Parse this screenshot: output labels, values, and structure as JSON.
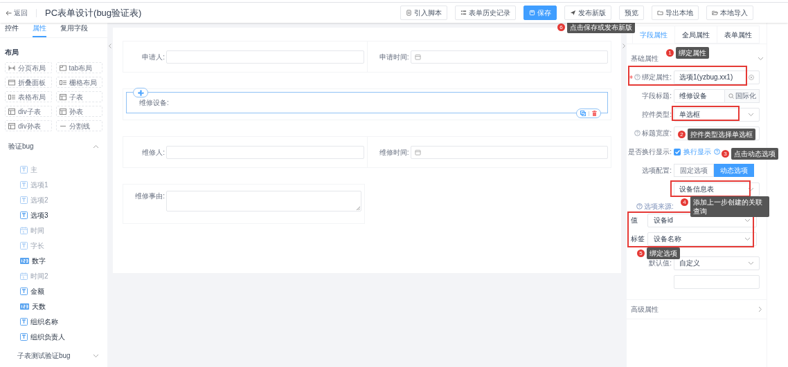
{
  "header": {
    "back": "返回",
    "title": "PC表单设计(bug验证表)",
    "buttons": [
      {
        "label": "引入脚本",
        "primary": false
      },
      {
        "label": "表单历史记录",
        "primary": false
      },
      {
        "label": "保存",
        "primary": true
      },
      {
        "label": "发布新版",
        "primary": false
      },
      {
        "label": "预览",
        "primary": false
      },
      {
        "label": "导出本地",
        "primary": false
      },
      {
        "label": "本地导入",
        "primary": false
      }
    ]
  },
  "left_panel": {
    "tabs": [
      {
        "label": "控件",
        "selected": false
      },
      {
        "label": "属性",
        "selected": true
      },
      {
        "label": "复用字段",
        "selected": false
      }
    ],
    "layout_heading": "布局",
    "layout_widgets": [
      {
        "label": "分页布局"
      },
      {
        "label": "tab布局"
      },
      {
        "label": "折叠面板"
      },
      {
        "label": "栅格布局"
      },
      {
        "label": "表格布局"
      },
      {
        "label": "子表"
      },
      {
        "label": "div子表"
      },
      {
        "label": "孙表"
      },
      {
        "label": "div孙表"
      },
      {
        "label": "分割线"
      }
    ],
    "groups": [
      {
        "title": "验证bug",
        "expanded": true,
        "fields": [
          {
            "label": "主",
            "kind": "text",
            "disabled": true
          },
          {
            "label": "选项1",
            "kind": "text",
            "disabled": true
          },
          {
            "label": "选项2",
            "kind": "text",
            "disabled": true
          },
          {
            "label": "选项3",
            "kind": "text",
            "disabled": false
          },
          {
            "label": "时间",
            "kind": "date",
            "disabled": true
          },
          {
            "label": "字长",
            "kind": "text",
            "disabled": true
          },
          {
            "label": "数字",
            "kind": "number",
            "disabled": false
          },
          {
            "label": "时间2",
            "kind": "date",
            "disabled": true
          },
          {
            "label": "金额",
            "kind": "text",
            "disabled": false
          },
          {
            "label": "天数",
            "kind": "number",
            "disabled": false
          },
          {
            "label": "组织名称",
            "kind": "text",
            "disabled": false
          },
          {
            "label": "组织负责人",
            "kind": "text",
            "disabled": false
          }
        ]
      },
      {
        "title": "子表测试验证bug",
        "expanded": false
      }
    ]
  },
  "canvas": {
    "rows": [
      {
        "selected": false,
        "cells": [
          {
            "label": "申请人:",
            "kind": "input"
          },
          {
            "label": "申请时间:",
            "kind": "date"
          }
        ]
      },
      {
        "selected": true,
        "cells": [
          {
            "label": "维修设备:",
            "kind": "radio"
          }
        ]
      },
      {
        "selected": false,
        "cells": [
          {
            "label": "维修人:",
            "kind": "input"
          },
          {
            "label": "维修时间:",
            "kind": "date"
          }
        ]
      },
      {
        "selected": false,
        "cells": [
          {
            "label": "维修事由:",
            "kind": "textarea"
          }
        ]
      }
    ]
  },
  "right_panel": {
    "tabs": [
      {
        "label": "字段属性",
        "selected": true
      },
      {
        "label": "全局属性",
        "selected": false
      },
      {
        "label": "表单属性",
        "selected": false
      }
    ],
    "section": {
      "title": "基础属性",
      "expanded": true
    },
    "properties": [
      {
        "kind": "input",
        "label": "绑定属性:",
        "required": true,
        "help": true,
        "value": "选项1(yzbug.xx1)",
        "clearable": true
      },
      {
        "kind": "addon",
        "label": "字段标题:",
        "value": "维修设备",
        "addon": "国际化"
      },
      {
        "kind": "select",
        "label": "控件类型:",
        "value": "单选框"
      },
      {
        "kind": "input",
        "label": "标题宽度:",
        "help": true
      },
      {
        "kind": "checkbox",
        "label": "是否换行显示:",
        "checked": true,
        "text": "换行显示",
        "help": true
      },
      {
        "kind": "segmented",
        "label": "选项配置:",
        "options": [
          {
            "label": "固定选项",
            "selected": false
          },
          {
            "label": "动态选项",
            "selected": true
          }
        ]
      },
      {
        "kind": "select",
        "value": "设备信息表"
      },
      {
        "kind": "caption",
        "text": "选项来源:"
      },
      {
        "kind": "bind",
        "label": "值",
        "value": "设备id"
      },
      {
        "kind": "bind",
        "label": "标签",
        "value": "设备名称"
      },
      {
        "kind": "select",
        "label": "默认值:",
        "value": "自定义"
      },
      {
        "kind": "input"
      }
    ],
    "advanced": {
      "title": "高级属性",
      "expanded": false
    }
  },
  "annotations": [
    {
      "number": "1",
      "text": "绑定属性"
    },
    {
      "number": "2",
      "text": "控件类型选择单选框"
    },
    {
      "number": "3",
      "text": "点击动态选项"
    },
    {
      "number": "4",
      "text": "添加上一步创建的关联查询"
    },
    {
      "number": "5",
      "text": "绑定选项"
    },
    {
      "number": "6",
      "text": "点击保存或发布新版"
    }
  ]
}
